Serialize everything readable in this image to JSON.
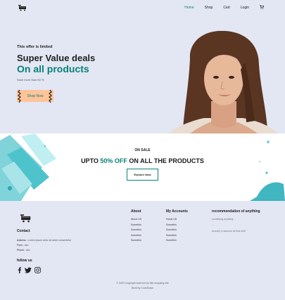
{
  "header": {
    "nav": [
      {
        "label": "Home",
        "active": true
      },
      {
        "label": "Shop",
        "active": false
      },
      {
        "label": "Cart",
        "active": false
      },
      {
        "label": "Login",
        "active": false
      }
    ]
  },
  "hero": {
    "tagline": "This offer is limited",
    "title": "Super Value deals",
    "subtitle": "On all products",
    "sub": "Save more than 50 %",
    "button": "Shop Now"
  },
  "banner": {
    "on_sale": "ON SALE",
    "head_prefix": "UPTO ",
    "head_pct": "50% OFF",
    "head_suffix": " ON ALL THE PRODUCTS",
    "button": "Explore Now"
  },
  "footer": {
    "contact_title": "Contact",
    "address_label": "Address :",
    "address_value": " Lorem ipsum dolor sit amet consectetur",
    "floor_label": "Floor :",
    "floor_value": " abc",
    "phone_label": "Phone :",
    "phone_value": " abc",
    "follow": "follow us",
    "about": {
      "title": "About",
      "items": [
        "About US",
        "Somethin",
        "Somethin",
        "Somethin",
        "Somethin"
      ]
    },
    "account": {
      "title": "My Accounts",
      "items": [
        "Home US",
        "Somethin",
        "Somethin",
        "Somethin",
        "Somethin"
      ]
    },
    "recommend": {
      "title": "recommendation of anything",
      "items": [
        "something anything",
        "- -",
        "security is assured all that stuff"
      ]
    },
    "copyright": "© 2020 Copyright reserved by this shopping site",
    "build": "Build by CodeDrake"
  },
  "colors": {
    "accent": "#088178",
    "bg": "#e3e6f3",
    "button": "#ffc499"
  }
}
